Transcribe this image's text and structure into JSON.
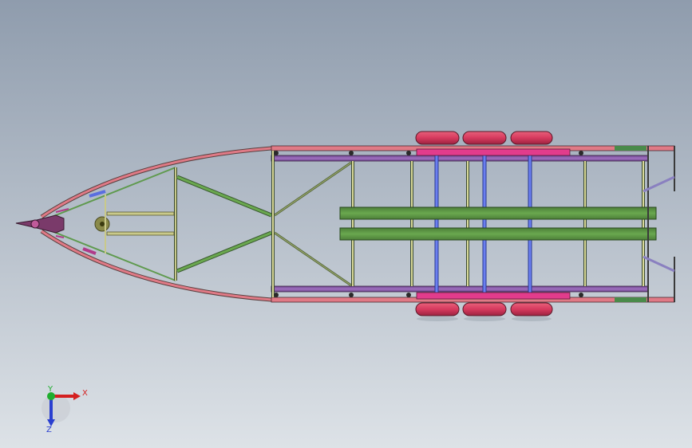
{
  "viewport": {
    "background_top": "#8f9cad",
    "background_bottom": "#dde2e7"
  },
  "model": {
    "name_icon": "boat-trailer-chassis",
    "colors": {
      "frame_rail": "#e07a86",
      "cross_member": "#c9c98a",
      "diagonal_brace": "#5f9a4e",
      "side_rail": "#8a5aa6",
      "bunk_board": "#5f9a45",
      "axle": "#5a6ee0",
      "wheel": "#d63a5e",
      "spring_hanger": "#e23c8c",
      "coupler": "#b03a8a"
    },
    "wheel_count": 6,
    "axle_count": 3
  },
  "triad": {
    "x_label": "X",
    "y_label": "Y",
    "z_label": "Z",
    "x_color": "#d42020",
    "y_color": "#1fae2e",
    "z_color": "#2a3fd0"
  }
}
